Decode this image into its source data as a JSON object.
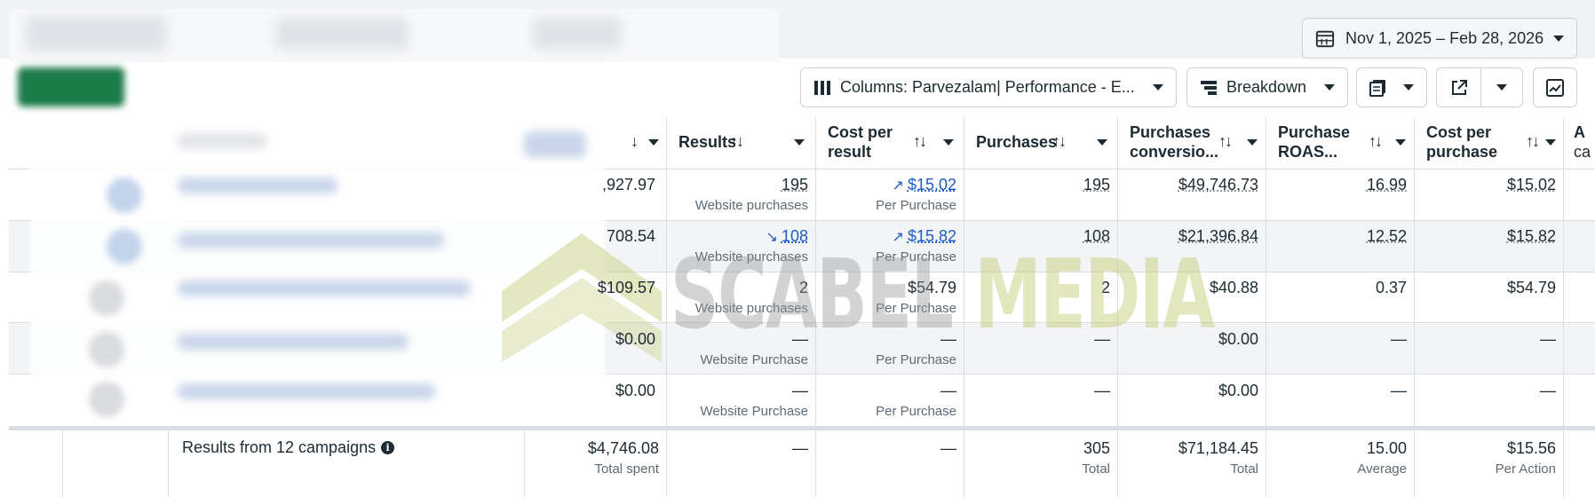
{
  "toolbar": {
    "date_range": "Nov 1, 2025 – Feb 28, 2026",
    "columns_label": "Columns: Parvezalam| Performance - E...",
    "breakdown_label": "Breakdown"
  },
  "columns": [
    {
      "key": "amount_spent",
      "label": ""
    },
    {
      "key": "results",
      "label": "Results"
    },
    {
      "key": "cost_per_result",
      "label": "Cost per result"
    },
    {
      "key": "purchases",
      "label": "Purchases"
    },
    {
      "key": "purchases_conversion",
      "label": "Purchases conversio..."
    },
    {
      "key": "purchase_roas",
      "label": "Purchase ROAS..."
    },
    {
      "key": "cost_per_purchase",
      "label": "Cost per purchase"
    },
    {
      "key": "extra",
      "label": "A ca"
    }
  ],
  "header_labels": {
    "results": "Results",
    "cost_per_result_1": "Cost per",
    "cost_per_result_2": "result",
    "purchases": "Purchases",
    "purchases_conv_1": "Purchases",
    "purchases_conv_2": "conversio...",
    "roas_1": "Purchase",
    "roas_2": "ROAS...",
    "cpp_1": "Cost per",
    "cpp_2": "purchase",
    "extra_1": "A",
    "extra_2": "ca"
  },
  "rows": [
    {
      "spent": ",927.97",
      "results": "195",
      "results_sub": "Website purchases",
      "cpr": "$15.02",
      "cpr_sub": "Per Purchase",
      "purchases": "195",
      "conv": "$49,746.73",
      "roas": "16.99",
      "cpp": "$15.02"
    },
    {
      "spent": "708.54",
      "results": "108",
      "results_sub": "Website purchases",
      "cpr": "$15.82",
      "cpr_sub": "Per Purchase",
      "purchases": "108",
      "conv": "$21,396.84",
      "roas": "12.52",
      "cpp": "$15.82"
    },
    {
      "spent": "$109.57",
      "results": "2",
      "results_sub": "Website purchases",
      "cpr": "$54.79",
      "cpr_sub": "Per Purchase",
      "purchases": "2",
      "conv": "$40.88",
      "roas": "0.37",
      "cpp": "$54.79"
    },
    {
      "spent": "$0.00",
      "results": "—",
      "results_sub": "Website Purchase",
      "cpr": "—",
      "cpr_sub": "Per Purchase",
      "purchases": "—",
      "conv": "$0.00",
      "roas": "—",
      "cpp": "—"
    },
    {
      "spent": "$0.00",
      "results": "—",
      "results_sub": "Website Purchase",
      "cpr": "—",
      "cpr_sub": "Per Purchase",
      "purchases": "—",
      "conv": "$0.00",
      "roas": "—",
      "cpp": "—"
    }
  ],
  "footer": {
    "label": "Results from 12 campaigns",
    "spent": "$4,746.08",
    "spent_sub": "Total spent",
    "results": "—",
    "cpr": "—",
    "purchases": "305",
    "purchases_sub": "Total",
    "conv": "$71,184.45",
    "conv_sub": "Total",
    "roas": "15.00",
    "roas_sub": "Average",
    "cpp": "$15.56",
    "cpp_sub": "Per Action"
  },
  "watermark": {
    "part1": "SCABEL ",
    "part2": "MEDIA"
  },
  "icons": {
    "calendar": "calendar-icon",
    "columns": "columns-icon",
    "breakdown": "breakdown-icon",
    "reports": "reports-icon",
    "export": "export-icon",
    "chart": "chart-icon",
    "info": "info-icon",
    "trend_up": "trend-up-icon",
    "trend_down": "trend-down-icon"
  },
  "colors": {
    "link": "#1d5cc4",
    "row_alt": "#f2f4f6",
    "border": "#dadde1"
  }
}
